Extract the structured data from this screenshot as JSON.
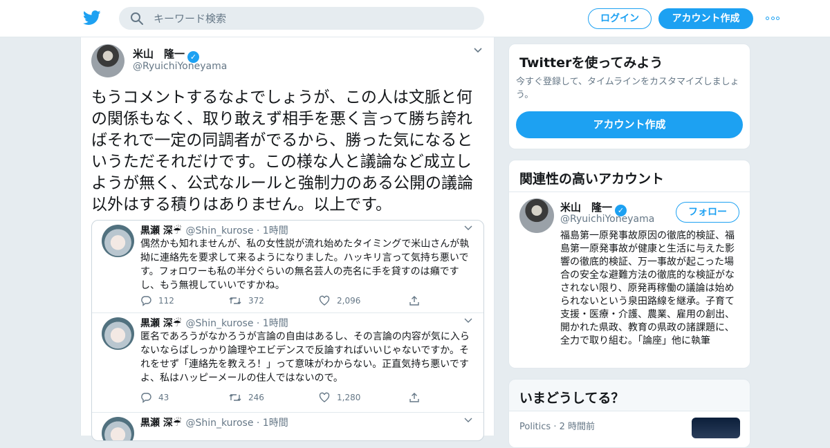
{
  "header": {
    "search_placeholder": "キーワード検索",
    "login_label": "ログイン",
    "signup_label": "アカウント作成",
    "brand_color": "#1da1f2"
  },
  "tweet": {
    "author_name": "米山　隆一",
    "author_handle": "@RyuichiYoneyama",
    "text": "もうコメントするなよでしょうが、この人は文脈と何の関係もなく、取り敢えず相手を悪く言って勝ち誇ればそれで一定の同調者がでるから、勝った気になるというただそれだけです。この様な人と議論など成立しようが無く、公式なルールと強制力のある公開の議論以外はする積りはありません。以上です。"
  },
  "embedded_screenshot": {
    "tweets": [
      {
        "name": "黒瀬 深☔",
        "meta": "@Shin_kurose · 1時間",
        "text": "偶然かも知れませんが、私の女性説が流れ始めたタイミングで米山さんが執拗に連絡先を要求して来るようになりました。ハッキリ言って気持ち悪いです。フォロワーも私の半分ぐらいの無名芸人の売名に手を貸すのは癪ですし、もう無視していいですかね。",
        "replies": "112",
        "retweets": "372",
        "likes": "2,096"
      },
      {
        "name": "黒瀬 深☔",
        "meta": "@Shin_kurose · 1時間",
        "text": "匿名であろうがなかろうが言論の自由はあるし、その言論の内容が気に入らないならばしっかり論理やエビデンスで反論すればいいじゃないですか。それをせず「連絡先を教えろ！」って意味がわからない。正直気持ち悪いですよ、私はハッピーメールの住人ではないので。",
        "replies": "43",
        "retweets": "246",
        "likes": "1,280"
      },
      {
        "name": "黒瀬 深☔",
        "meta": "@Shin_kurose · 1時間",
        "text": "",
        "replies": "",
        "retweets": "",
        "likes": ""
      }
    ]
  },
  "sidebar": {
    "try_title": "Twitterを使ってみよう",
    "try_sub": "今すぐ登録して、タイムラインをカスタマイズしましょう。",
    "try_button": "アカウント作成",
    "related_title": "関連性の高いアカウント",
    "related_name": "米山　隆一",
    "related_handle": "@RyuichiYoneyama",
    "follow_label": "フォロー",
    "related_bio": "福島第一原発事故原因の徹底的検証、福島第一原発事故が健康と生活に与えた影響の徹底的検証、万一事故が起こった場合の安全な避難方法の徹底的な検証がなされない限り、原発再稼働の議論は始められないという泉田路線を継承。子育て支援・医療・介護、農業、雇用の創出、開かれた県政、教育の県政の諸課題に、全力で取り組む。「論座」他に執筆",
    "trends_title": "いまどうしてる？",
    "trend_category": "Politics",
    "trend_time": "2 時間前"
  }
}
